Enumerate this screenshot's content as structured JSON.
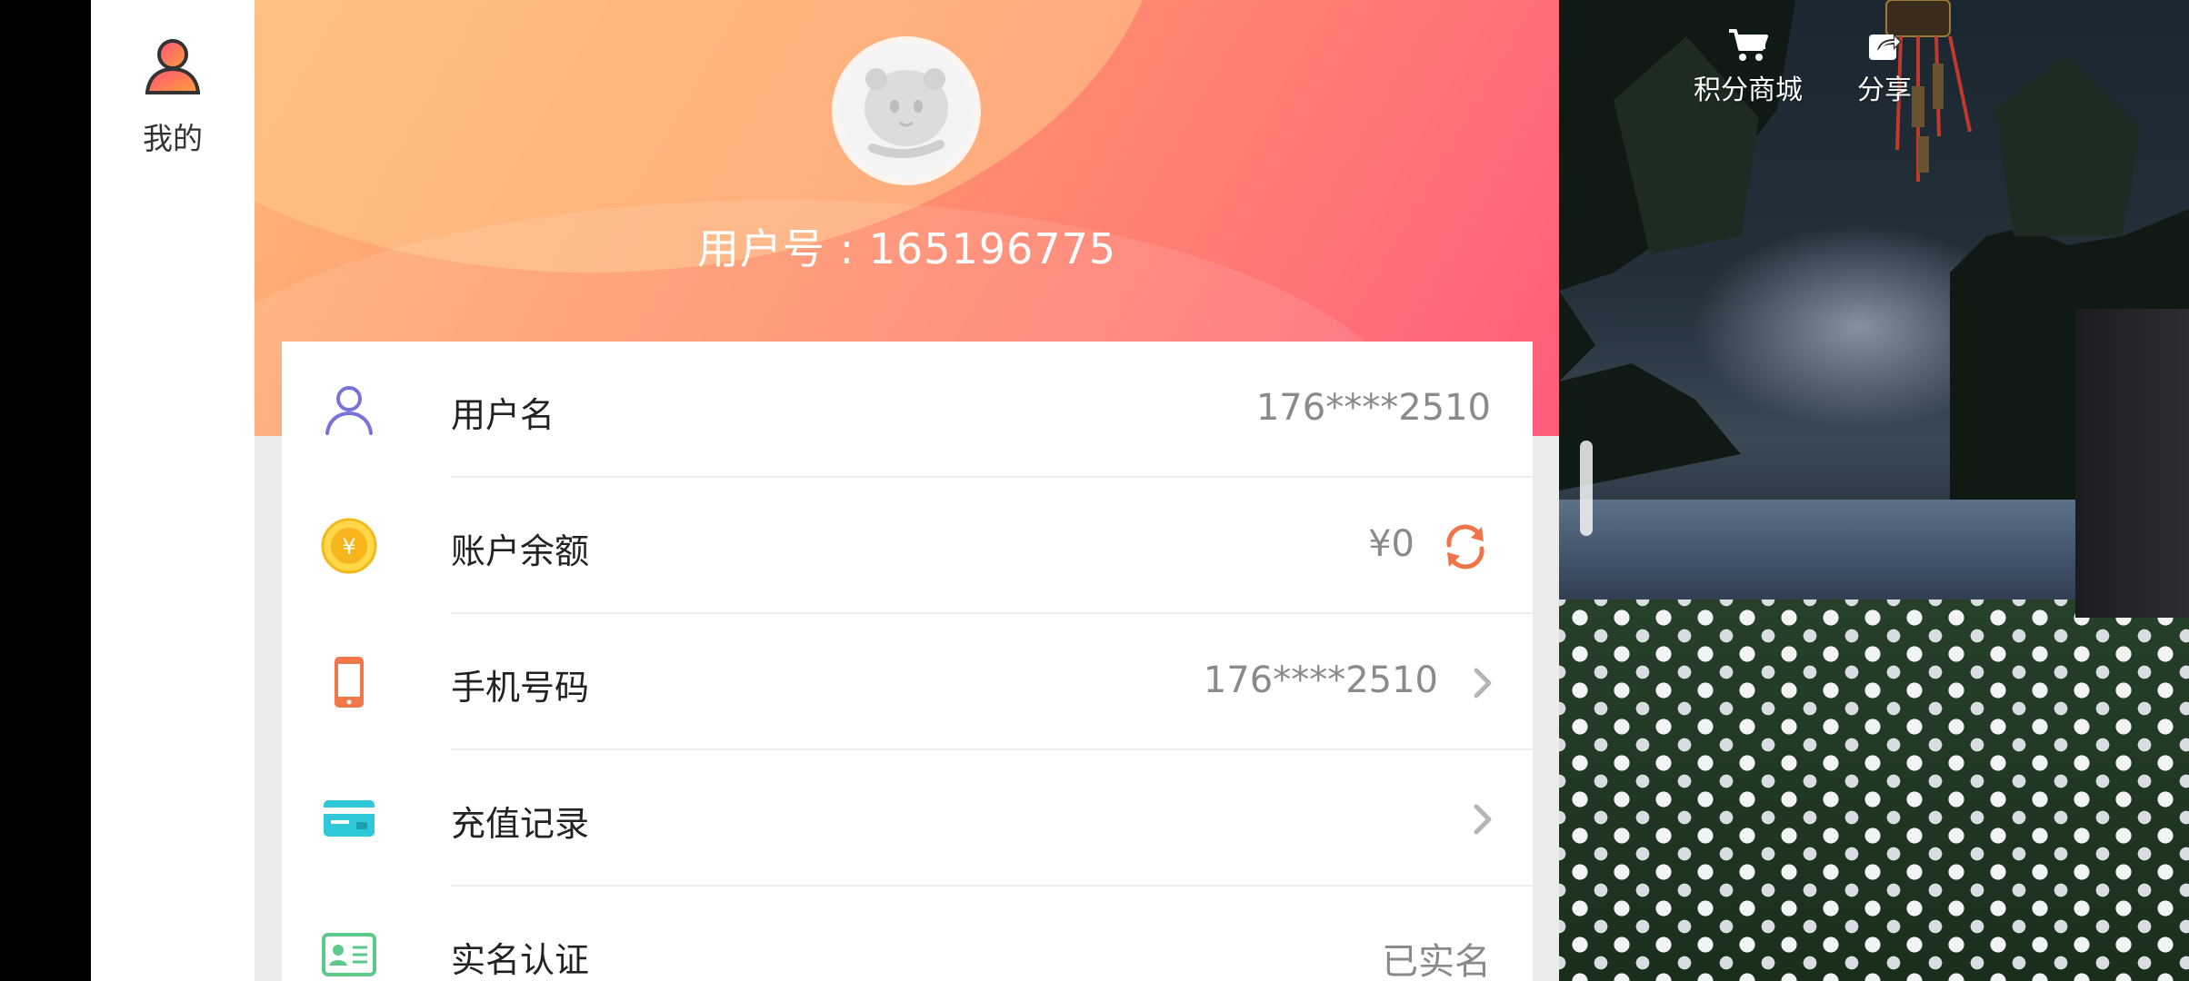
{
  "sidenav": {
    "items": [
      {
        "label": "我的",
        "icon": "user-icon",
        "active": true
      }
    ]
  },
  "profile": {
    "user_id_text": "用户号 : 165196775"
  },
  "rows": [
    {
      "label": "用户名",
      "value": "176****2510",
      "icon": "user-outline-icon"
    },
    {
      "label": "账户余额",
      "value": "¥0",
      "icon": "coin-yen-icon",
      "action": "refresh-icon"
    },
    {
      "label": "手机号码",
      "value": "176****2510",
      "icon": "phone-icon",
      "action": "chevron-right-icon"
    },
    {
      "label": "充值记录",
      "value": "",
      "icon": "card-icon",
      "action": "chevron-right-icon"
    },
    {
      "label": "实名认证",
      "value": "已实名",
      "icon": "id-card-icon"
    }
  ],
  "scene": {
    "buttons": [
      {
        "label": "积分商城",
        "icon": "cart-icon"
      },
      {
        "label": "分享",
        "icon": "share-icon"
      }
    ]
  },
  "colors": {
    "accent_orange": "#f0744a",
    "hero_start": "#ffb57a",
    "hero_end": "#ff5c7c",
    "value_gray": "#8a8a8a"
  }
}
